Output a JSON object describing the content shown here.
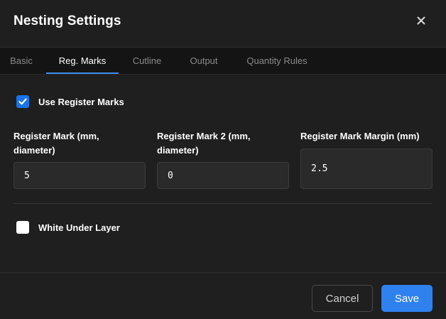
{
  "dialog": {
    "title": "Nesting Settings"
  },
  "tabs": [
    {
      "label": "Basic",
      "active": false
    },
    {
      "label": "Reg. Marks",
      "active": true
    },
    {
      "label": "Cutline",
      "active": false
    },
    {
      "label": "Output",
      "active": false
    },
    {
      "label": "Quantity Rules",
      "active": false
    }
  ],
  "reg_marks": {
    "use_register_marks": {
      "label": "Use Register Marks",
      "checked": true
    },
    "fields": [
      {
        "label": "Register Mark (mm, diameter)",
        "value": "5"
      },
      {
        "label": "Register Mark 2 (mm, diameter)",
        "value": "0"
      },
      {
        "label": "Register Mark Margin (mm)",
        "value": "2.5"
      }
    ],
    "white_under_layer": {
      "label": "White Under Layer",
      "checked": false
    }
  },
  "footer": {
    "cancel_label": "Cancel",
    "save_label": "Save"
  },
  "colors": {
    "accent": "#2f81f0",
    "background": "#1f1f1f",
    "tabbar": "#141414",
    "input_bg": "#2a2a2a"
  },
  "icons": {
    "close": "close-icon",
    "check": "checkmark-icon"
  }
}
